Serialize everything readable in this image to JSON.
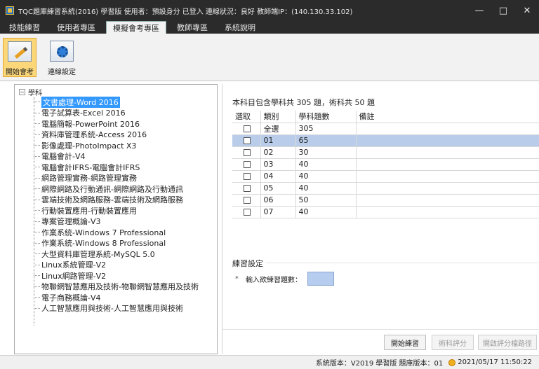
{
  "window": {
    "title": "TQC題庫練習系統(2016) 學習版 使用者：預設身分 已登入 連線狀況：良好 教師端IP：(140.130.33.102)",
    "minimize": "—",
    "maximize": "□",
    "close": "✕"
  },
  "menu": {
    "tabs": [
      {
        "label": "技能練習"
      },
      {
        "label": "使用者專區"
      },
      {
        "label": "模擬會考專區"
      },
      {
        "label": "教師專區"
      },
      {
        "label": "系統說明"
      }
    ]
  },
  "ribbon": {
    "start_exam": "開始會考",
    "connection_settings": "連線設定"
  },
  "tree": {
    "root": "學科",
    "items": [
      "文書處理-Word 2016",
      "電子試算表-Excel 2016",
      "電腦簡報-PowerPoint 2016",
      "資料庫管理系統-Access 2016",
      "影像處理-PhotoImpact X3",
      "電腦會計-V4",
      "電腦會計IFRS-電腦會計IFRS",
      "網路管理實務-網路管理實務",
      "網際網路及行動通訊-網際網路及行動通訊",
      "雲端技術及網路服務-雲端技術及網路服務",
      "行動裝置應用-行動裝置應用",
      "專案管理概論-V3",
      "作業系統-Windows 7 Professional",
      "作業系統-Windows 8 Professional",
      "大型資料庫管理系統-MySQL 5.0",
      "Linux系統管理-V2",
      "Linux網路管理-V2",
      "物聯網智慧應用及技術-物聯網智慧應用及技術",
      "電子商務概論-V4",
      "人工智慧應用與技術-人工智慧應用與技術"
    ]
  },
  "summary": "本科目包含學科共 305 題，術科共 50 題",
  "grid": {
    "headers": [
      "選取",
      "類別",
      "學科題數",
      "備註"
    ],
    "rows": [
      {
        "category": "全選",
        "count": "305",
        "note": ""
      },
      {
        "category": "01",
        "count": "65",
        "note": ""
      },
      {
        "category": "02",
        "count": "30",
        "note": ""
      },
      {
        "category": "03",
        "count": "40",
        "note": ""
      },
      {
        "category": "04",
        "count": "40",
        "note": ""
      },
      {
        "category": "05",
        "count": "40",
        "note": ""
      },
      {
        "category": "06",
        "count": "50",
        "note": ""
      },
      {
        "category": "07",
        "count": "40",
        "note": ""
      }
    ]
  },
  "settings": {
    "label": "練習設定",
    "star": "*",
    "input_label": "輸入欲練習題數："
  },
  "buttons": {
    "start_practice": "開始練習",
    "practical_score": "術科評分",
    "open_score_file": "開啟評分檔路徑"
  },
  "status": {
    "version": "系統版本：V2019 學習版 題庫版本：01",
    "datetime": "2021/05/17 11:50:22"
  }
}
